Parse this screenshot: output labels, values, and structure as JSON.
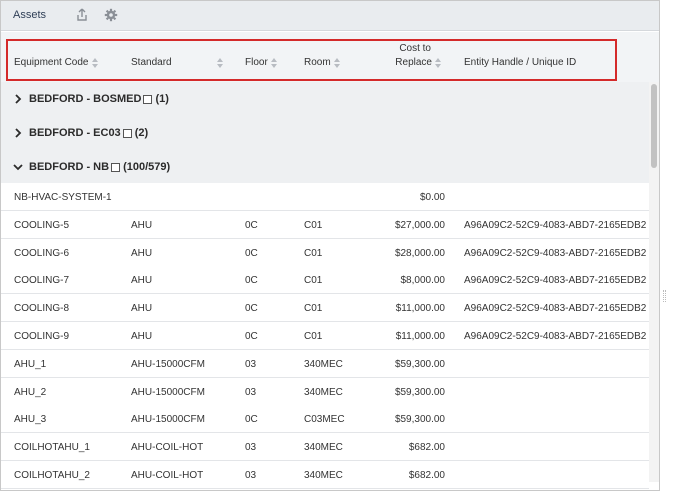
{
  "panel": {
    "title": "Assets",
    "share_icon": "share-icon",
    "settings_icon": "gear-icon"
  },
  "columns": [
    {
      "label": "Equipment Code"
    },
    {
      "label": "Standard"
    },
    {
      "label": "Floor"
    },
    {
      "label": "Room"
    },
    {
      "label_line1": "Cost to",
      "label_line2": "Replace"
    },
    {
      "label": "Entity Handle / Unique ID"
    }
  ],
  "groups": [
    {
      "name": "BEDFORD - BOSMED",
      "count": "(1)",
      "expanded": false
    },
    {
      "name": "BEDFORD - EC03",
      "count": "(2)",
      "expanded": false
    },
    {
      "name": "BEDFORD - NB",
      "count": "(100/579)",
      "expanded": true
    }
  ],
  "rows": [
    {
      "code": "NB-HVAC-SYSTEM-1",
      "standard": "",
      "floor": "",
      "room": "",
      "cost": "$0.00",
      "entity": ""
    },
    {
      "code": "COOLING-5",
      "standard": "AHU",
      "floor": "0C",
      "room": "C01",
      "cost": "$27,000.00",
      "entity": "A96A09C2-52C9-4083-ABD7-2165EDB2"
    },
    {
      "code": "COOLING-6",
      "standard": "AHU",
      "floor": "0C",
      "room": "C01",
      "cost": "$28,000.00",
      "entity": "A96A09C2-52C9-4083-ABD7-2165EDB2"
    },
    {
      "code": "COOLING-7",
      "standard": "AHU",
      "floor": "0C",
      "room": "C01",
      "cost": "$8,000.00",
      "entity": "A96A09C2-52C9-4083-ABD7-2165EDB2"
    },
    {
      "code": "COOLING-8",
      "standard": "AHU",
      "floor": "0C",
      "room": "C01",
      "cost": "$11,000.00",
      "entity": "A96A09C2-52C9-4083-ABD7-2165EDB2"
    },
    {
      "code": "COOLING-9",
      "standard": "AHU",
      "floor": "0C",
      "room": "C01",
      "cost": "$11,000.00",
      "entity": "A96A09C2-52C9-4083-ABD7-2165EDB2"
    },
    {
      "code": "AHU_1",
      "standard": "AHU-15000CFM",
      "floor": "03",
      "room": "340MEC",
      "cost": "$59,300.00",
      "entity": ""
    },
    {
      "code": "AHU_2",
      "standard": "AHU-15000CFM",
      "floor": "03",
      "room": "340MEC",
      "cost": "$59,300.00",
      "entity": ""
    },
    {
      "code": "AHU_3",
      "standard": "AHU-15000CFM",
      "floor": "0C",
      "room": "C03MEC",
      "cost": "$59,300.00",
      "entity": ""
    },
    {
      "code": "COILHOTAHU_1",
      "standard": "AHU-COIL-HOT",
      "floor": "03",
      "room": "340MEC",
      "cost": "$682.00",
      "entity": ""
    },
    {
      "code": "COILHOTAHU_2",
      "standard": "AHU-COIL-HOT",
      "floor": "03",
      "room": "340MEC",
      "cost": "$682.00",
      "entity": ""
    }
  ],
  "colors": {
    "highlight": "#d42a2a",
    "header_bg": "#e9ecef",
    "group_bg": "#eef0f2"
  }
}
